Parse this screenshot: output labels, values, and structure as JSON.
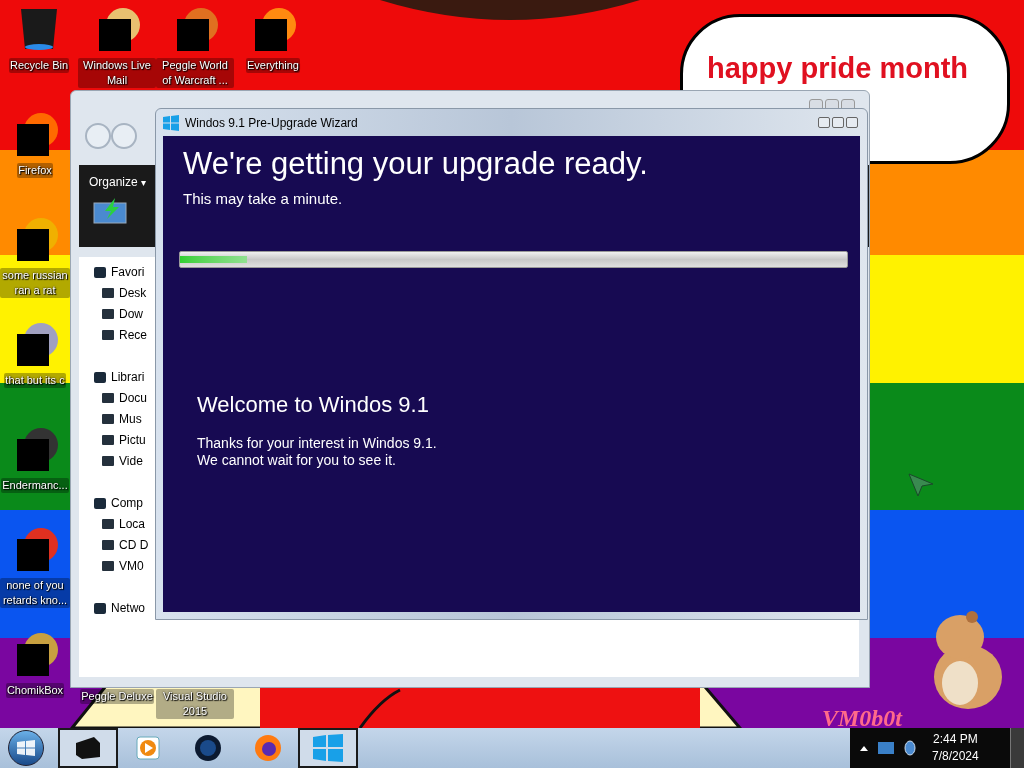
{
  "desktop_icons": [
    {
      "label": "Recycle Bin",
      "kind": "bin"
    },
    {
      "label": "Windows Live Mail",
      "kind": "covered"
    },
    {
      "label": "Peggle World of Warcraft ...",
      "kind": "covered"
    },
    {
      "label": "Everything",
      "kind": "covered"
    },
    {
      "label": "Firefox",
      "kind": "covered"
    },
    {
      "label": "some russian ran a rat",
      "kind": "covered"
    },
    {
      "label": "that but its c",
      "kind": "covered"
    },
    {
      "label": "Endermanc...",
      "kind": "covered"
    },
    {
      "label": "none of you retards kno...",
      "kind": "covered"
    },
    {
      "label": "ChomikBox",
      "kind": "covered"
    },
    {
      "label": "Peggle Deluxe",
      "kind": "label"
    },
    {
      "label": "Visual Studio 2015",
      "kind": "label"
    }
  ],
  "speech_bubble": {
    "text": "happy pride month"
  },
  "wallpaper_text": "VM0b0t",
  "explorer": {
    "toolbar": {
      "organize": "Organize",
      "organize_caret": "▾"
    },
    "nav": [
      {
        "label": "Favori",
        "children": [
          {
            "label": "Desk"
          },
          {
            "label": "Dow"
          },
          {
            "label": "Rece"
          }
        ]
      },
      {
        "label": "Librari",
        "children": [
          {
            "label": "Docu"
          },
          {
            "label": "Mus"
          },
          {
            "label": "Pictu"
          },
          {
            "label": "Vide"
          }
        ]
      },
      {
        "label": "Comp",
        "children": [
          {
            "label": "Loca"
          },
          {
            "label": "CD D"
          },
          {
            "label": "VM0"
          }
        ]
      },
      {
        "label": "Netwo"
      }
    ]
  },
  "wizard": {
    "title": "Windos 9.1 Pre-Upgrade Wizard",
    "heading": "We're getting your upgrade ready.",
    "subheading": "This may take a minute.",
    "progress": {
      "level": 0.1
    },
    "welcome_title": "Welcome to Windos 9.1",
    "welcome_lines": [
      "Thanks for your interest in Windos 9.1.",
      "We cannot wait for you to see it."
    ]
  },
  "taskbar": {
    "buttons": [
      {
        "kind": "explorer",
        "selected": true
      },
      {
        "kind": "media",
        "selected": false
      },
      {
        "kind": "globe",
        "selected": false
      },
      {
        "kind": "firefox",
        "selected": false
      },
      {
        "kind": "windows",
        "selected": true
      }
    ],
    "clock": {
      "time": "2:44 PM",
      "date": "7/8/2024"
    }
  }
}
